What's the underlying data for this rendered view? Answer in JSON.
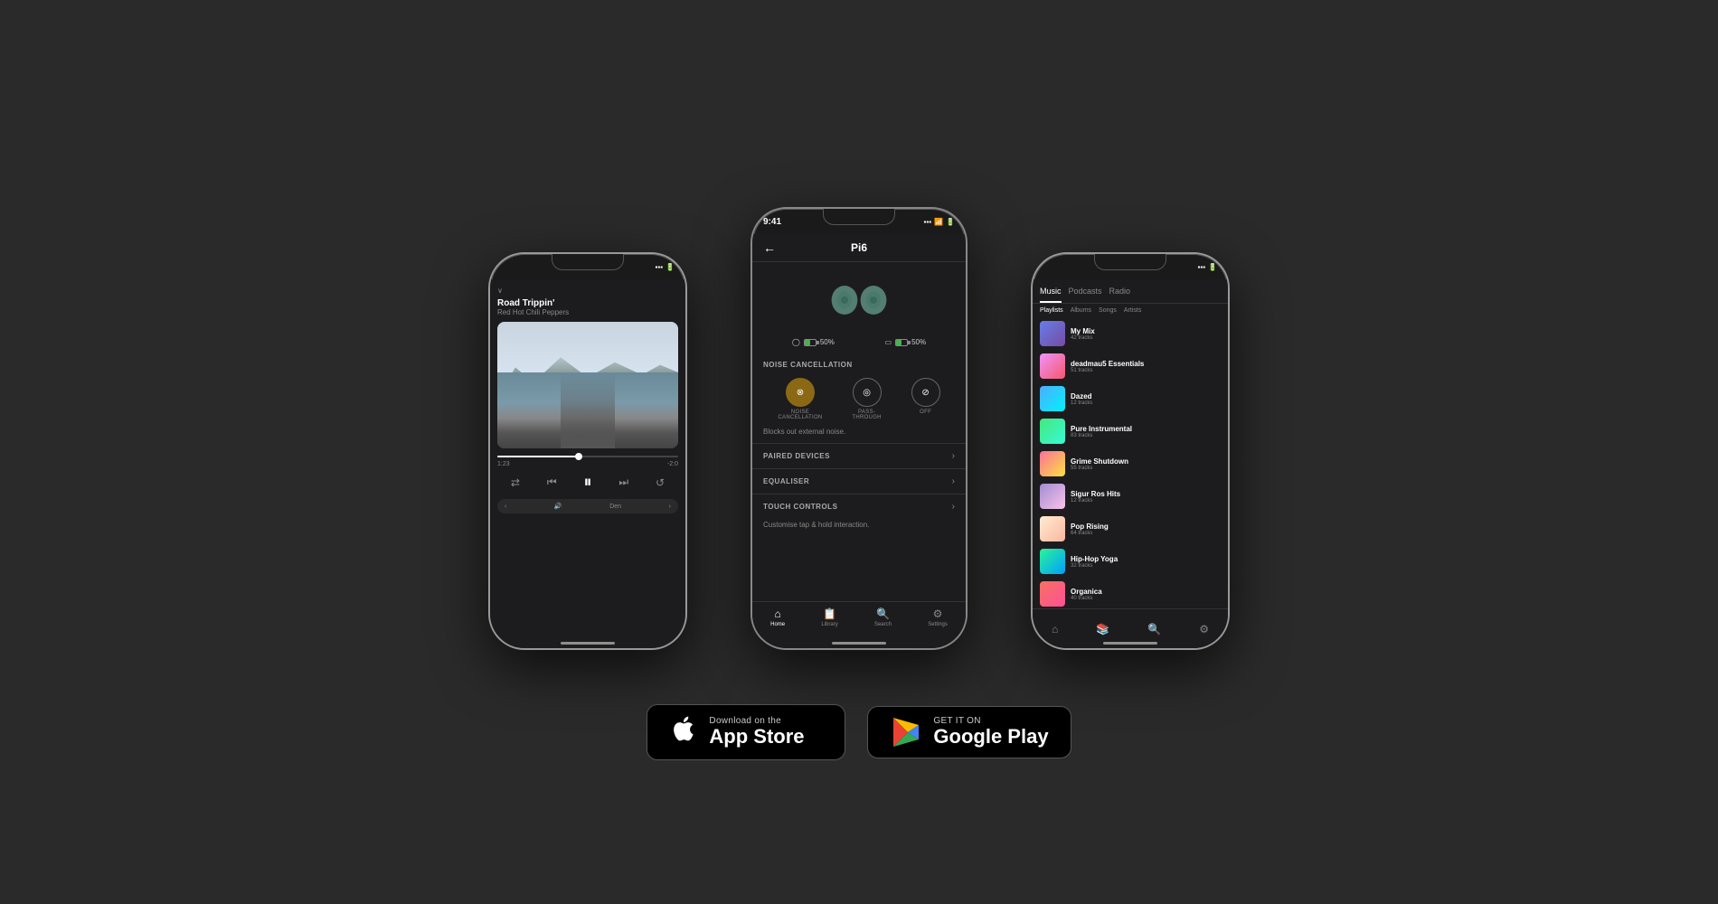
{
  "page": {
    "background": "#2a2a2a"
  },
  "phones": {
    "left": {
      "status_time": "",
      "track_title": "Road Trippin'",
      "track_artist": "Red Hot Chili Peppers",
      "progress_current": "1:23",
      "progress_total": "-2:0",
      "device_name": "Den",
      "controls": {
        "shuffle": "⇄",
        "prev": "⏮",
        "play": "⏸",
        "next": "⏭",
        "repeat": "↺"
      }
    },
    "center": {
      "status_time": "9:41",
      "device_name": "Pi6",
      "battery_left_pct": "50%",
      "battery_right_pct": "50%",
      "noise_cancellation": {
        "label": "NOISE CANCELLATION",
        "modes": [
          {
            "name": "NOISE\nCANCELLATION",
            "active": true
          },
          {
            "name": "PASS-\nTHROUGH",
            "active": false
          },
          {
            "name": "OFF",
            "active": false
          }
        ],
        "description": "Blocks out external noise."
      },
      "paired_devices": "PAIRED DEVICES",
      "equaliser": "EQUALISER",
      "touch_controls": "TOUCH CONTROLS",
      "touch_description": "Customise tap & hold interaction.",
      "tabs": [
        {
          "label": "Home",
          "icon": "⌂",
          "active": true
        },
        {
          "label": "Library",
          "icon": "📋",
          "active": false
        },
        {
          "label": "Search",
          "icon": "🔍",
          "active": false
        },
        {
          "label": "Settings",
          "icon": "⚙",
          "active": false
        }
      ]
    },
    "right": {
      "tabs": [
        "Music",
        "Podcasts",
        "Radio"
      ],
      "subtabs": [
        "Playlists",
        "Albums",
        "Songs",
        "Artists"
      ],
      "playlists": [
        {
          "name": "My Mix",
          "tracks": "42 tracks",
          "thumb": "thumb-1"
        },
        {
          "name": "deadmau5 Essentials",
          "tracks": "51 tracks",
          "thumb": "thumb-2"
        },
        {
          "name": "Dazed",
          "tracks": "12 tracks",
          "thumb": "thumb-3"
        },
        {
          "name": "Pure Instrumental",
          "tracks": "83 tracks",
          "thumb": "thumb-4"
        },
        {
          "name": "Grime Shutdown",
          "tracks": "55 tracks",
          "thumb": "thumb-5"
        },
        {
          "name": "Sigur Ros Hits",
          "tracks": "12 tracks",
          "thumb": "thumb-6"
        },
        {
          "name": "Pop Rising",
          "tracks": "64 tracks",
          "thumb": "thumb-7"
        },
        {
          "name": "Hip-Hop Yoga",
          "tracks": "32 tracks",
          "thumb": "thumb-8"
        },
        {
          "name": "Organica",
          "tracks": "40 tracks",
          "thumb": "thumb-9"
        }
      ]
    }
  },
  "store_buttons": {
    "app_store": {
      "sub_label": "Download on the",
      "main_label": "App Store"
    },
    "google_play": {
      "sub_label": "GET IT ON",
      "main_label": "Google Play"
    }
  }
}
